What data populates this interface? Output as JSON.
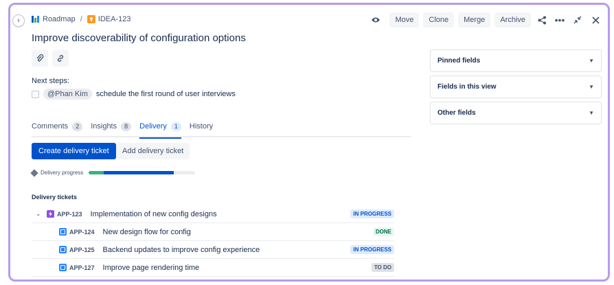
{
  "breadcrumb": {
    "project": "Roadmap",
    "separator": "/",
    "issue_key": "IDEA-123"
  },
  "title": "Improve discoverability of configuration options",
  "toolbar": {
    "move": "Move",
    "clone": "Clone",
    "merge": "Merge",
    "archive": "Archive"
  },
  "next_steps": {
    "label": "Next steps:",
    "mention": "@Phan Kim",
    "text": "schedule the first round of user interviews"
  },
  "tabs": [
    {
      "label": "Comments",
      "count": "2"
    },
    {
      "label": "Insights",
      "count": "8"
    },
    {
      "label": "Delivery",
      "count": "1"
    },
    {
      "label": "History"
    }
  ],
  "actions": {
    "create": "Create delivery ticket",
    "add": "Add delivery ticket"
  },
  "progress": {
    "label": "Delivery progress",
    "done_fraction": 0.14,
    "in_progress_fraction": 0.66
  },
  "delivery_title": "Delivery tickets",
  "tickets": [
    {
      "key": "APP-123",
      "summary": "Implementation of new config designs",
      "status": "IN PROGRESS"
    },
    {
      "key": "APP-124",
      "summary": "New design flow for config",
      "status": "DONE"
    },
    {
      "key": "APP-125",
      "summary": "Backend updates to improve config experience",
      "status": "IN PROGRESS"
    },
    {
      "key": "APP-127",
      "summary": "Improve page rendering time",
      "status": "TO DO"
    }
  ],
  "side_panel": [
    {
      "label": "Pinned fields"
    },
    {
      "label": "Fields in this view"
    },
    {
      "label": "Other fields"
    }
  ],
  "colors": {
    "accent": "#0052cc",
    "frame": "#b89af0",
    "done": "#36b37e"
  }
}
